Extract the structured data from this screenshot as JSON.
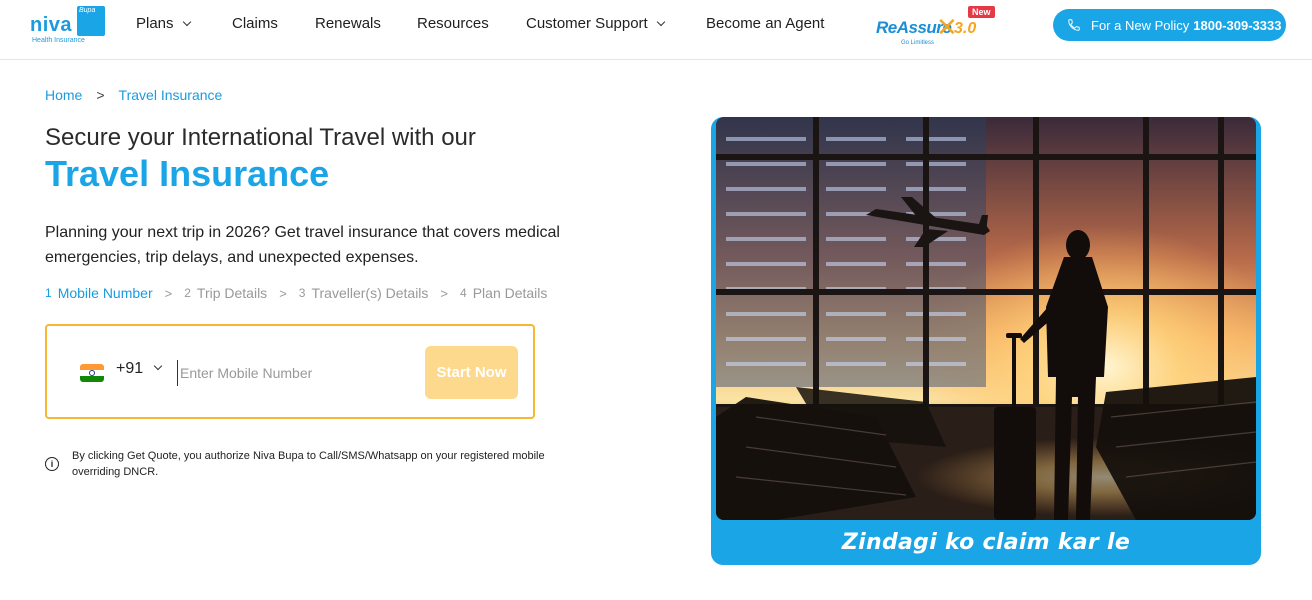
{
  "header": {
    "logo": {
      "word": "niva",
      "badge": "Bupa",
      "sub": "Health Insurance"
    },
    "nav": [
      {
        "label": "Plans",
        "has_dropdown": true
      },
      {
        "label": "Claims",
        "has_dropdown": false
      },
      {
        "label": "Renewals",
        "has_dropdown": false
      },
      {
        "label": "Resources",
        "has_dropdown": false
      },
      {
        "label": "Customer Support",
        "has_dropdown": true
      },
      {
        "label": "Become an Agent",
        "has_dropdown": false
      }
    ],
    "reassure": {
      "text": "ReAssure",
      "version": "3.0",
      "tagline": "Go Limitless",
      "badge": "New"
    },
    "cta": {
      "label": "For a New Policy",
      "phone": "1800-309-3333",
      "icon": "phone-icon"
    }
  },
  "breadcrumb": {
    "home": "Home",
    "separator": ">",
    "current": "Travel Insurance"
  },
  "hero_text": {
    "line1": "Secure your International Travel with our",
    "line2": "Travel Insurance",
    "description": "Planning your next trip in 2026? Get travel insurance that covers medical emergencies, trip delays, and unexpected expenses."
  },
  "steps": [
    {
      "num": "1",
      "label": "Mobile Number",
      "active": true
    },
    {
      "num": "2",
      "label": "Trip Details",
      "active": false
    },
    {
      "num": "3",
      "label": "Traveller(s) Details",
      "active": false
    },
    {
      "num": "4",
      "label": "Plan Details",
      "active": false
    }
  ],
  "steps_separator": ">",
  "form": {
    "country_code": "+91",
    "flag_icon": "india-flag-icon",
    "mobile_placeholder": "Enter Mobile Number",
    "mobile_value": "",
    "start_button": "Start Now"
  },
  "disclaimer": {
    "icon": "info-icon",
    "text": "By clicking Get Quote, you authorize Niva Bupa to Call/SMS/Whatsapp on your registered mobile overriding DNCR."
  },
  "hero_image": {
    "caption": "Zindagi ko claim kar le"
  },
  "colors": {
    "brand": "#1aa5e6",
    "accent": "#f7b733",
    "button_disabled": "#fdd98e"
  }
}
